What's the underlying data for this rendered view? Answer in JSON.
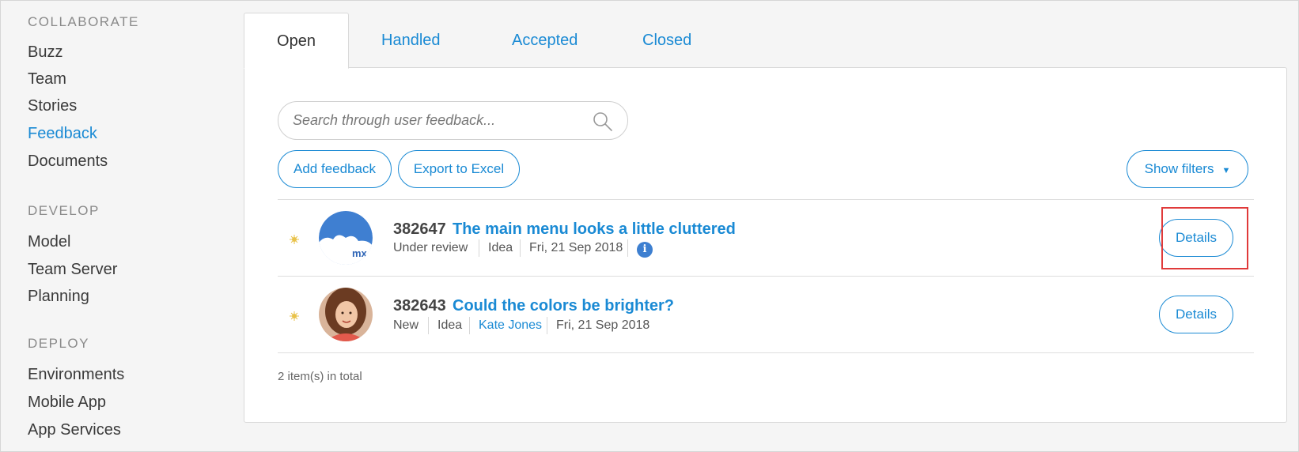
{
  "sidebar": {
    "sections": [
      {
        "title": "COLLABORATE",
        "items": [
          "Buzz",
          "Team",
          "Stories",
          "Feedback",
          "Documents"
        ]
      },
      {
        "title": "DEVELOP",
        "items": [
          "Model",
          "Team Server",
          "Planning"
        ]
      },
      {
        "title": "DEPLOY",
        "items": [
          "Environments",
          "Mobile App",
          "App Services"
        ]
      }
    ],
    "active_item": "Feedback"
  },
  "tabs": [
    "Open",
    "Handled",
    "Accepted",
    "Closed"
  ],
  "active_tab": "Open",
  "search": {
    "placeholder": "Search through user feedback..."
  },
  "toolbar": {
    "add_label": "Add feedback",
    "export_label": "Export to Excel",
    "filters_label": "Show filters",
    "filters_caret": "▼"
  },
  "feedback": [
    {
      "id": "382647",
      "title": "The main menu looks a little cluttered",
      "status": "Under review",
      "type": "Idea",
      "date": "Fri, 21 Sep 2018",
      "avatar": "mendix-cloud-logo",
      "avatar_text": "mx",
      "info_icon": "i",
      "details_label": "Details"
    },
    {
      "id": "382643",
      "title": "Could the colors be brighter?",
      "status": "New",
      "type": "Idea",
      "author": "Kate Jones",
      "date": "Fri, 21 Sep 2018",
      "avatar": "user-photo",
      "details_label": "Details"
    }
  ],
  "total_text": "2 item(s) in total",
  "colors": {
    "accent": "#1a8ad4",
    "highlight": "#e03a3a"
  }
}
